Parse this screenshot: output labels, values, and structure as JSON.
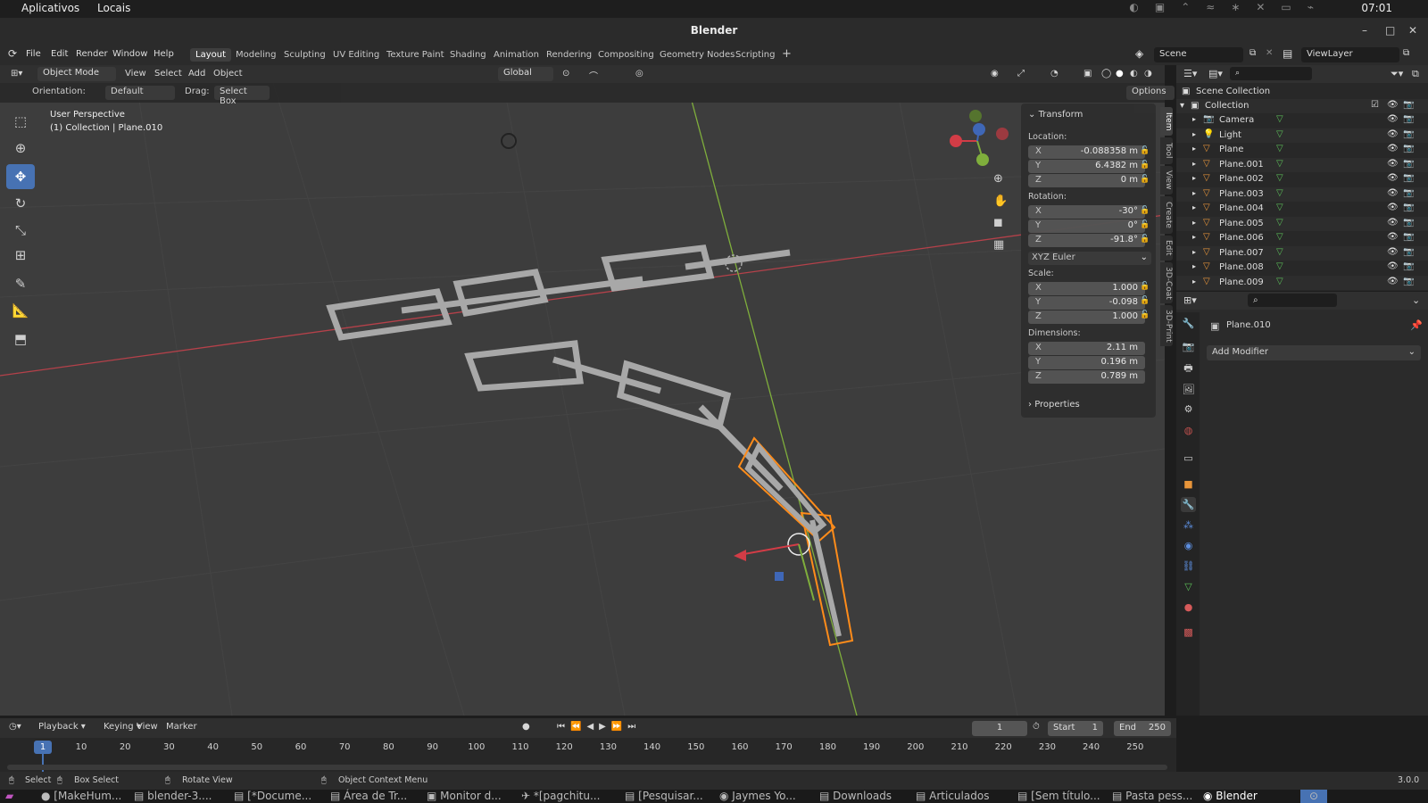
{
  "gnome": {
    "apps": "Aplicativos",
    "places": "Locais",
    "clock": "07:01"
  },
  "window": {
    "title": "Blender"
  },
  "menu": [
    "File",
    "Edit",
    "Render",
    "Window",
    "Help"
  ],
  "workspaces": [
    "Layout",
    "Modeling",
    "Sculpting",
    "UV Editing",
    "Texture Paint",
    "Shading",
    "Animation",
    "Rendering",
    "Compositing",
    "Geometry Nodes",
    "Scripting"
  ],
  "scene": {
    "scene_name": "Scene",
    "view_layer": "ViewLayer"
  },
  "viewport_header": {
    "mode": "Object Mode",
    "view": "View",
    "select": "Select",
    "add": "Add",
    "object": "Object",
    "transform_orientation": "Global",
    "orientation_label": "Orientation:",
    "orientation_value": "Default",
    "drag_label": "Drag:",
    "drag_value": "Select Box",
    "options": "Options"
  },
  "viewport_info": {
    "perspective": "User Perspective",
    "collection": "(1) Collection | Plane.010"
  },
  "npanel": {
    "section": "Transform",
    "location_label": "Location:",
    "location": [
      {
        "axis": "X",
        "value": "-0.088358 m"
      },
      {
        "axis": "Y",
        "value": "6.4382 m"
      },
      {
        "axis": "Z",
        "value": "0 m"
      }
    ],
    "rotation_label": "Rotation:",
    "rotation": [
      {
        "axis": "X",
        "value": "-30°"
      },
      {
        "axis": "Y",
        "value": "0°"
      },
      {
        "axis": "Z",
        "value": "-91.8°"
      }
    ],
    "rotation_mode": "XYZ Euler",
    "scale_label": "Scale:",
    "scale": [
      {
        "axis": "X",
        "value": "1.000"
      },
      {
        "axis": "Y",
        "value": "-0.098"
      },
      {
        "axis": "Z",
        "value": "1.000"
      }
    ],
    "dimensions_label": "Dimensions:",
    "dimensions": [
      {
        "axis": "X",
        "value": "2.11 m"
      },
      {
        "axis": "Y",
        "value": "0.196 m"
      },
      {
        "axis": "Z",
        "value": "0.789 m"
      }
    ],
    "properties": "Properties",
    "tabs": [
      "Item",
      "Tool",
      "View",
      "Create",
      "Edit",
      "3D-Coat",
      "3D-Print"
    ]
  },
  "outliner": {
    "root": "Scene Collection",
    "collection": "Collection",
    "items": [
      "Camera",
      "Light",
      "Plane",
      "Plane.001",
      "Plane.002",
      "Plane.003",
      "Plane.004",
      "Plane.005",
      "Plane.006",
      "Plane.007",
      "Plane.008",
      "Plane.009"
    ]
  },
  "properties": {
    "object_name": "Plane.010",
    "add_modifier": "Add Modifier"
  },
  "timeline": {
    "playback": "Playback",
    "keying": "Keying",
    "view": "View",
    "marker": "Marker",
    "current_frame": "1",
    "start_label": "Start",
    "start": "1",
    "end_label": "End",
    "end": "250",
    "ticks": [
      "10",
      "20",
      "30",
      "40",
      "50",
      "60",
      "70",
      "80",
      "90",
      "100",
      "110",
      "120",
      "130",
      "140",
      "150",
      "160",
      "170",
      "180",
      "190",
      "200",
      "210",
      "220",
      "230",
      "240",
      "250"
    ],
    "current_tick": "1"
  },
  "status": {
    "select": "Select",
    "box_select": "Box Select",
    "rotate": "Rotate View",
    "context": "Object Context Menu",
    "version": "3.0.0"
  },
  "taskbar": [
    "[MakeHum...",
    "blender-3....",
    "[*Docume...",
    "Área de Tr...",
    "Monitor d...",
    "*[pagchitu...",
    "[Pesquisar...",
    "Jaymes Yo...",
    "Downloads",
    "Articulados",
    "[Sem título...",
    "Pasta pess...",
    "Blender"
  ],
  "colors": {
    "accent": "#4772b3",
    "selection": "#ff8c1a",
    "axis_x": "#c0323b",
    "axis_y": "#7fae3c"
  }
}
